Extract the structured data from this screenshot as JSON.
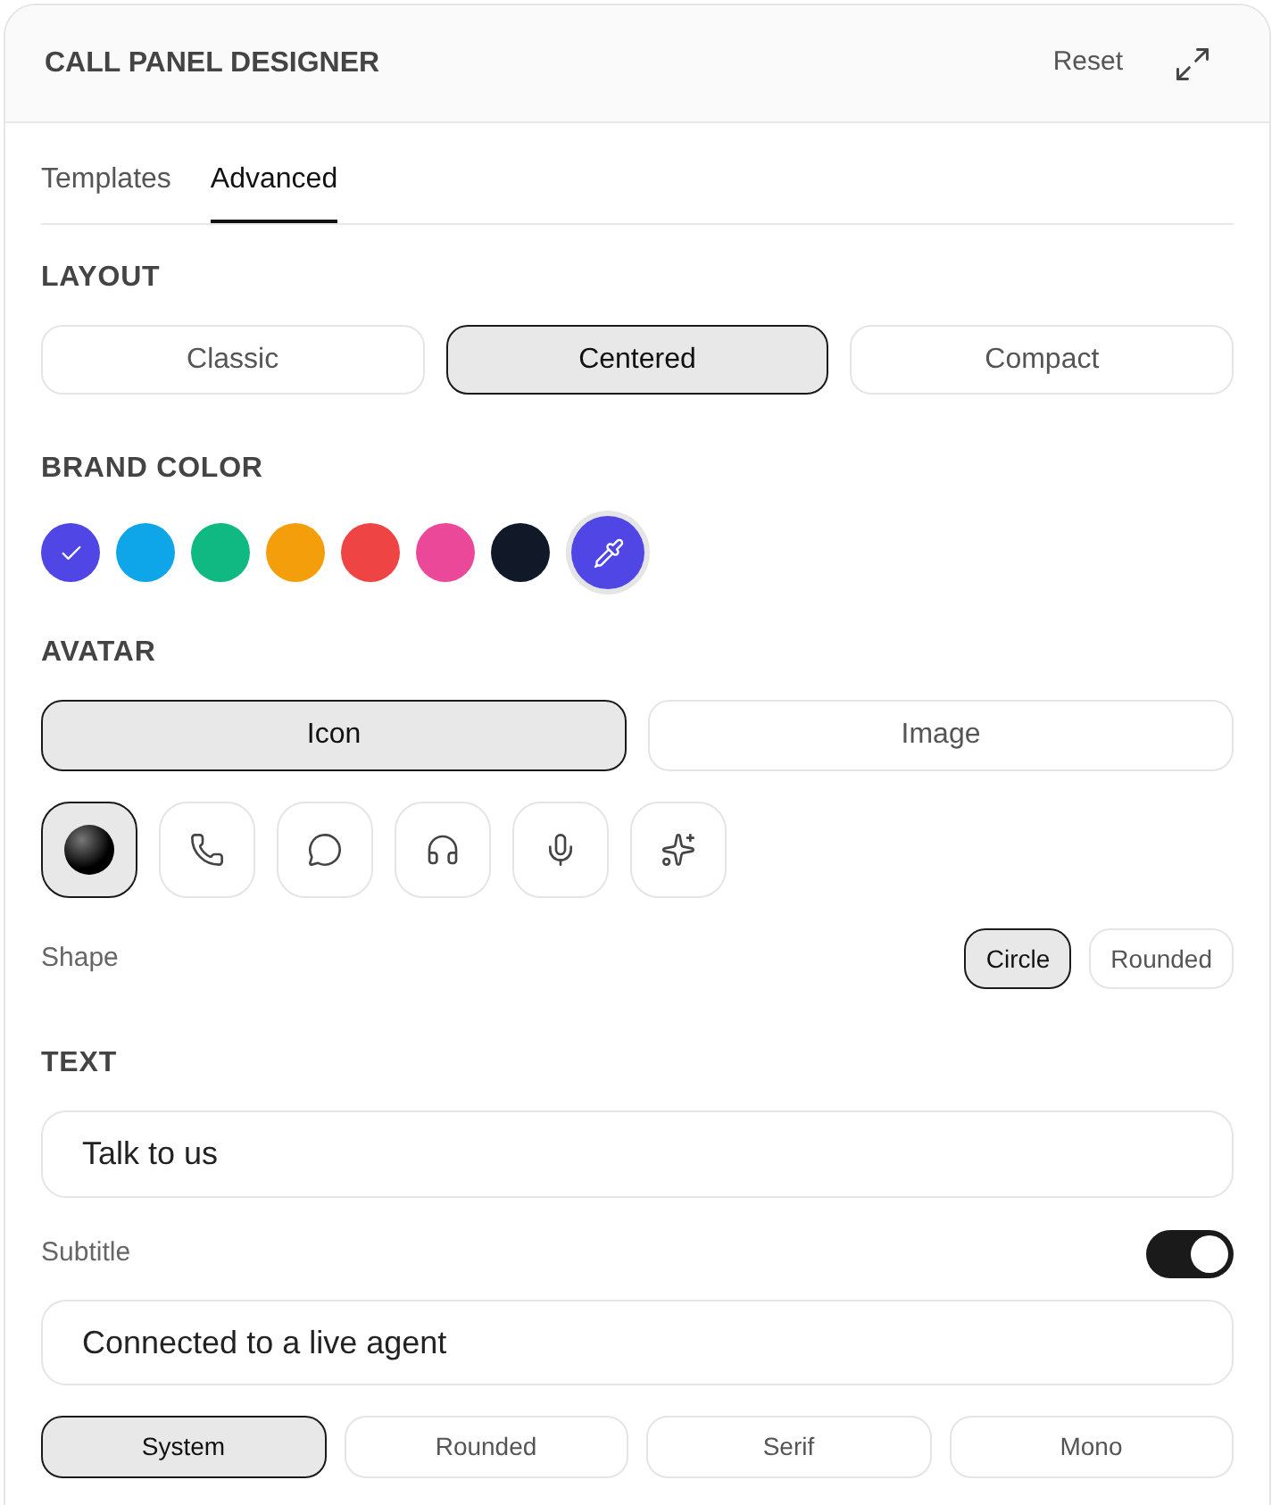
{
  "header": {
    "title": "CALL PANEL DESIGNER",
    "reset": "Reset"
  },
  "tabs": [
    {
      "label": "Templates",
      "selected": false
    },
    {
      "label": "Advanced",
      "selected": true
    }
  ],
  "layout": {
    "heading": "LAYOUT",
    "options": [
      {
        "label": "Classic",
        "selected": false
      },
      {
        "label": "Centered",
        "selected": true
      },
      {
        "label": "Compact",
        "selected": false
      }
    ]
  },
  "brand_color": {
    "heading": "BRAND COLOR",
    "swatches": [
      {
        "color": "#4f46e5",
        "selected": true
      },
      {
        "color": "#0ea5e9",
        "selected": false
      },
      {
        "color": "#10b981",
        "selected": false
      },
      {
        "color": "#f59e0b",
        "selected": false
      },
      {
        "color": "#ef4444",
        "selected": false
      },
      {
        "color": "#ec4899",
        "selected": false
      },
      {
        "color": "#111827",
        "selected": false
      }
    ],
    "picker": {
      "color": "#4f46e5"
    }
  },
  "avatar": {
    "heading": "AVATAR",
    "modes": [
      {
        "label": "Icon",
        "selected": true
      },
      {
        "label": "Image",
        "selected": false
      }
    ],
    "icons": [
      {
        "kind": "orb",
        "selected": true
      },
      {
        "kind": "phone",
        "selected": false
      },
      {
        "kind": "chat",
        "selected": false
      },
      {
        "kind": "headphones",
        "selected": false
      },
      {
        "kind": "mic",
        "selected": false
      },
      {
        "kind": "sparkles",
        "selected": false
      }
    ],
    "shape_label": "Shape",
    "shapes": [
      {
        "label": "Circle",
        "selected": true
      },
      {
        "label": "Rounded",
        "selected": false
      }
    ]
  },
  "text": {
    "heading": "TEXT",
    "title_value": "Talk to us",
    "subtitle_label": "Subtitle",
    "subtitle_on": true,
    "subtitle_value": "Connected to a live agent",
    "fonts": [
      {
        "label": "System",
        "selected": true
      },
      {
        "label": "Rounded",
        "selected": false
      },
      {
        "label": "Serif",
        "selected": false
      },
      {
        "label": "Mono",
        "selected": false
      }
    ]
  }
}
